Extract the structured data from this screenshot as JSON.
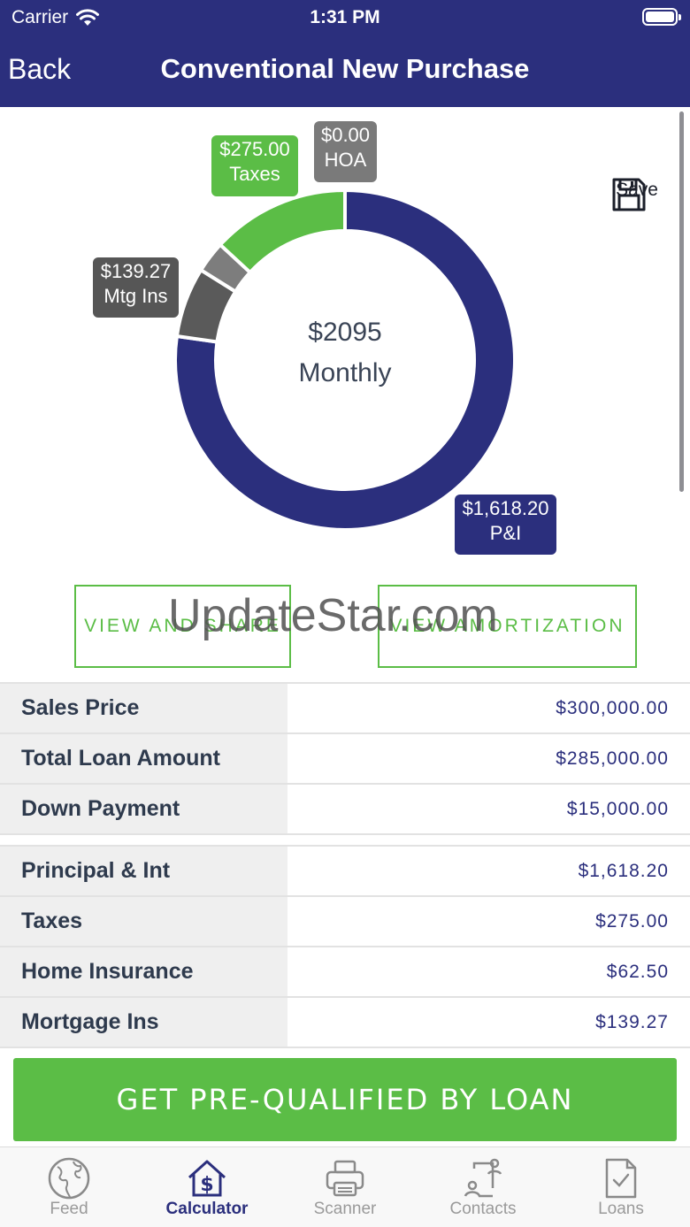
{
  "status": {
    "carrier": "Carrier",
    "time": "1:31 PM"
  },
  "nav": {
    "back_label": "Back",
    "title": "Conventional New Purchase"
  },
  "chart": {
    "center_amount": "$2095",
    "center_label": "Monthly",
    "tags": {
      "taxes": {
        "amount": "$275.00",
        "label": "Taxes"
      },
      "hoa": {
        "amount": "$0.00",
        "label": "HOA"
      },
      "mtg_ins": {
        "amount": "$139.27",
        "label": "Mtg Ins"
      },
      "pi": {
        "amount": "$1,618.20",
        "label": "P&I"
      }
    }
  },
  "chart_data": {
    "type": "pie",
    "categories": [
      "P&I",
      "Mtg Ins",
      "Home Insurance",
      "Taxes",
      "HOA"
    ],
    "values": [
      1618.2,
      139.27,
      62.5,
      275.0,
      0.0
    ],
    "colors": [
      "#2b2f7d",
      "#5a5a5a",
      "#7d7d7d",
      "#5bbd46",
      "#7a7a7a"
    ],
    "total_label": "$2095 Monthly"
  },
  "save": {
    "label": "Save"
  },
  "buttons": {
    "share": "VIEW AND SHARE",
    "amortization": "VIEW AMORTIZATION"
  },
  "watermark": "UpdateStar.com",
  "loan_table": [
    {
      "label": "Sales Price",
      "value": "$300,000.00"
    },
    {
      "label": "Total Loan Amount",
      "value": "$285,000.00"
    },
    {
      "label": "Down Payment",
      "value": "$15,000.00"
    }
  ],
  "payment_table": [
    {
      "label": "Principal & Int",
      "value": "$1,618.20"
    },
    {
      "label": "Taxes",
      "value": "$275.00"
    },
    {
      "label": "Home Insurance",
      "value": "$62.50"
    },
    {
      "label": "Mortgage Ins",
      "value": "$139.27"
    }
  ],
  "cta": {
    "label": "GET PRE-QUALIFIED BY LOAN"
  },
  "tabs": [
    {
      "label": "Feed",
      "icon": "globe-icon"
    },
    {
      "label": "Calculator",
      "icon": "house-dollar-icon"
    },
    {
      "label": "Scanner",
      "icon": "printer-icon"
    },
    {
      "label": "Contacts",
      "icon": "contacts-icon"
    },
    {
      "label": "Loans",
      "icon": "document-check-icon"
    }
  ],
  "active_tab": "Calculator"
}
